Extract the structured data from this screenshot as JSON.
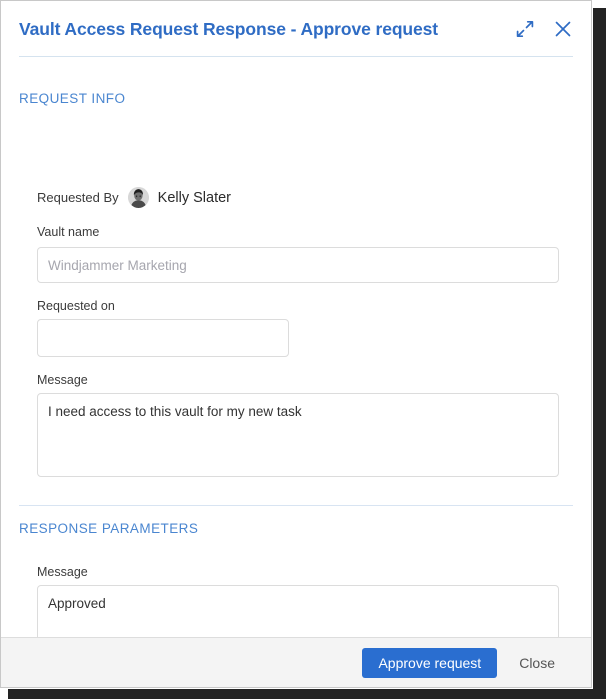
{
  "dialog": {
    "title": "Vault Access Request Response - Approve request",
    "title_color": "#2f6cc4",
    "expand_icon": "expand-diagonal-icon",
    "close_icon": "close-x-icon"
  },
  "request_info": {
    "section_title": "REQUEST INFO",
    "requested_by_label": "Requested By",
    "requested_by_name": "Kelly Slater",
    "vault_name_label": "Vault name",
    "vault_name_placeholder": "Windjammer Marketing",
    "vault_name_value": "",
    "requested_on_label": "Requested on",
    "requested_on_placeholder": "",
    "requested_on_value": "",
    "message_label": "Message",
    "message_value": "I need access to this vault for my new task"
  },
  "response_parameters": {
    "section_title": "RESPONSE PARAMETERS",
    "message_label": "Message",
    "message_value": "Approved"
  },
  "footer": {
    "approve_label": "Approve request",
    "approve_color": "#2a6ed0",
    "close_label": "Close"
  }
}
